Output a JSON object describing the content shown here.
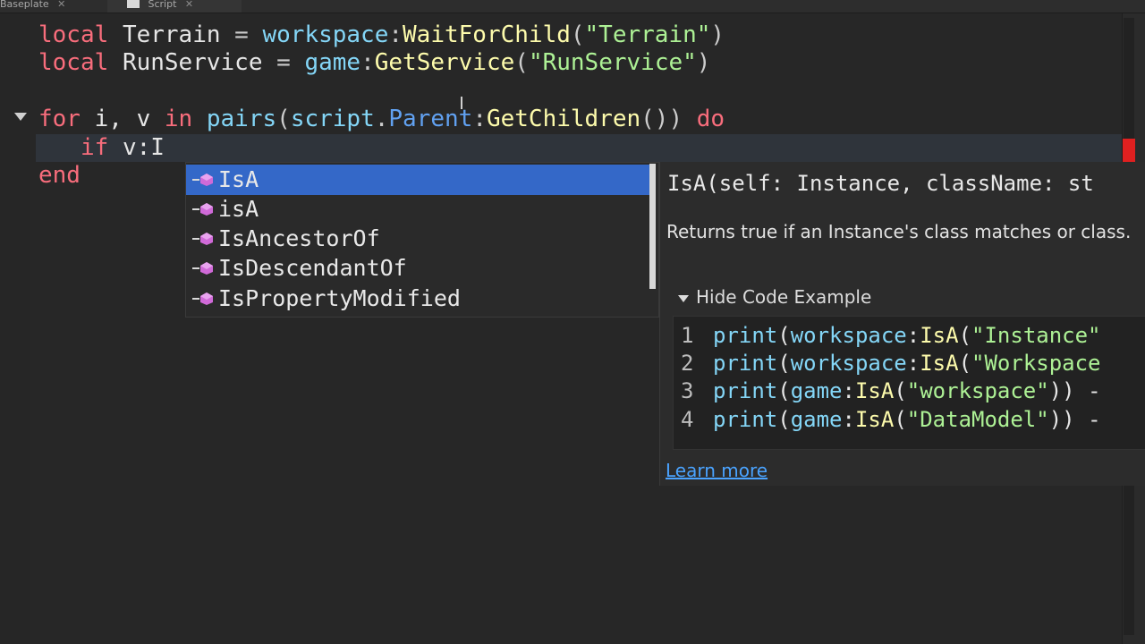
{
  "tabs": [
    {
      "label": "Baseplate",
      "close": "✕"
    },
    {
      "label": "Script",
      "close": "✕"
    }
  ],
  "code": {
    "line1": {
      "kw": "local",
      "var": "Terrain",
      "eq": "=",
      "obj": "workspace",
      "sep": ":",
      "method": "WaitForChild",
      "open": "(",
      "str": "\"Terrain\"",
      "close": ")"
    },
    "line2": {
      "kw": "local",
      "var": "RunService",
      "eq": "=",
      "obj": "game",
      "sep": ":",
      "method": "GetService",
      "open": "(",
      "str": "\"RunService\"",
      "close": ")"
    },
    "line4": {
      "kw_for": "for",
      "vars": "i, v",
      "kw_in": "in",
      "fn": "pairs",
      "open": "(",
      "obj": "script",
      "dot": ".",
      "prop": "Parent",
      "sep": ":",
      "method": "GetChildren",
      "parens": "())",
      "kw_do": "do"
    },
    "line5": {
      "kw_if": "if",
      "text": "v:I"
    },
    "line6": {
      "kw_end": "end"
    }
  },
  "autocomplete": {
    "items": [
      {
        "label": "IsA",
        "selected": true
      },
      {
        "label": "isA",
        "selected": false
      },
      {
        "label": "IsAncestorOf",
        "selected": false
      },
      {
        "label": "IsDescendantOf",
        "selected": false
      },
      {
        "label": "IsPropertyModified",
        "selected": false
      }
    ],
    "item_icon": "method-icon"
  },
  "doc": {
    "signature": "IsA(self: Instance, className: st",
    "description": "Returns true if an Instance's class matches or class.",
    "toggle": "Hide Code Example",
    "example": [
      {
        "num": "1",
        "fn": "print",
        "o1": "(",
        "obj": "workspace",
        "sep": ":",
        "m": "IsA",
        "o2": "(",
        "str": "\"Instance\"",
        "tail": ""
      },
      {
        "num": "2",
        "fn": "print",
        "o1": "(",
        "obj": "workspace",
        "sep": ":",
        "m": "IsA",
        "o2": "(",
        "str": "\"Workspace",
        "tail": ""
      },
      {
        "num": "3",
        "fn": "print",
        "o1": "(",
        "obj": "game",
        "sep": ":",
        "m": "IsA",
        "o2": "(",
        "str": "\"workspace\"",
        "tail": ")) -"
      },
      {
        "num": "4",
        "fn": "print",
        "o1": "(",
        "obj": "game",
        "sep": ":",
        "m": "IsA",
        "o2": "(",
        "str": "\"DataModel\"",
        "tail": ")) -"
      }
    ],
    "learn_more": "Learn more"
  },
  "colors": {
    "keyword": "#f86d7c",
    "function": "#fdfbac",
    "builtin": "#84d6f7",
    "string": "#adf195",
    "property": "#61a1f1",
    "selection": "#3468c8",
    "link": "#4aa3ff"
  }
}
